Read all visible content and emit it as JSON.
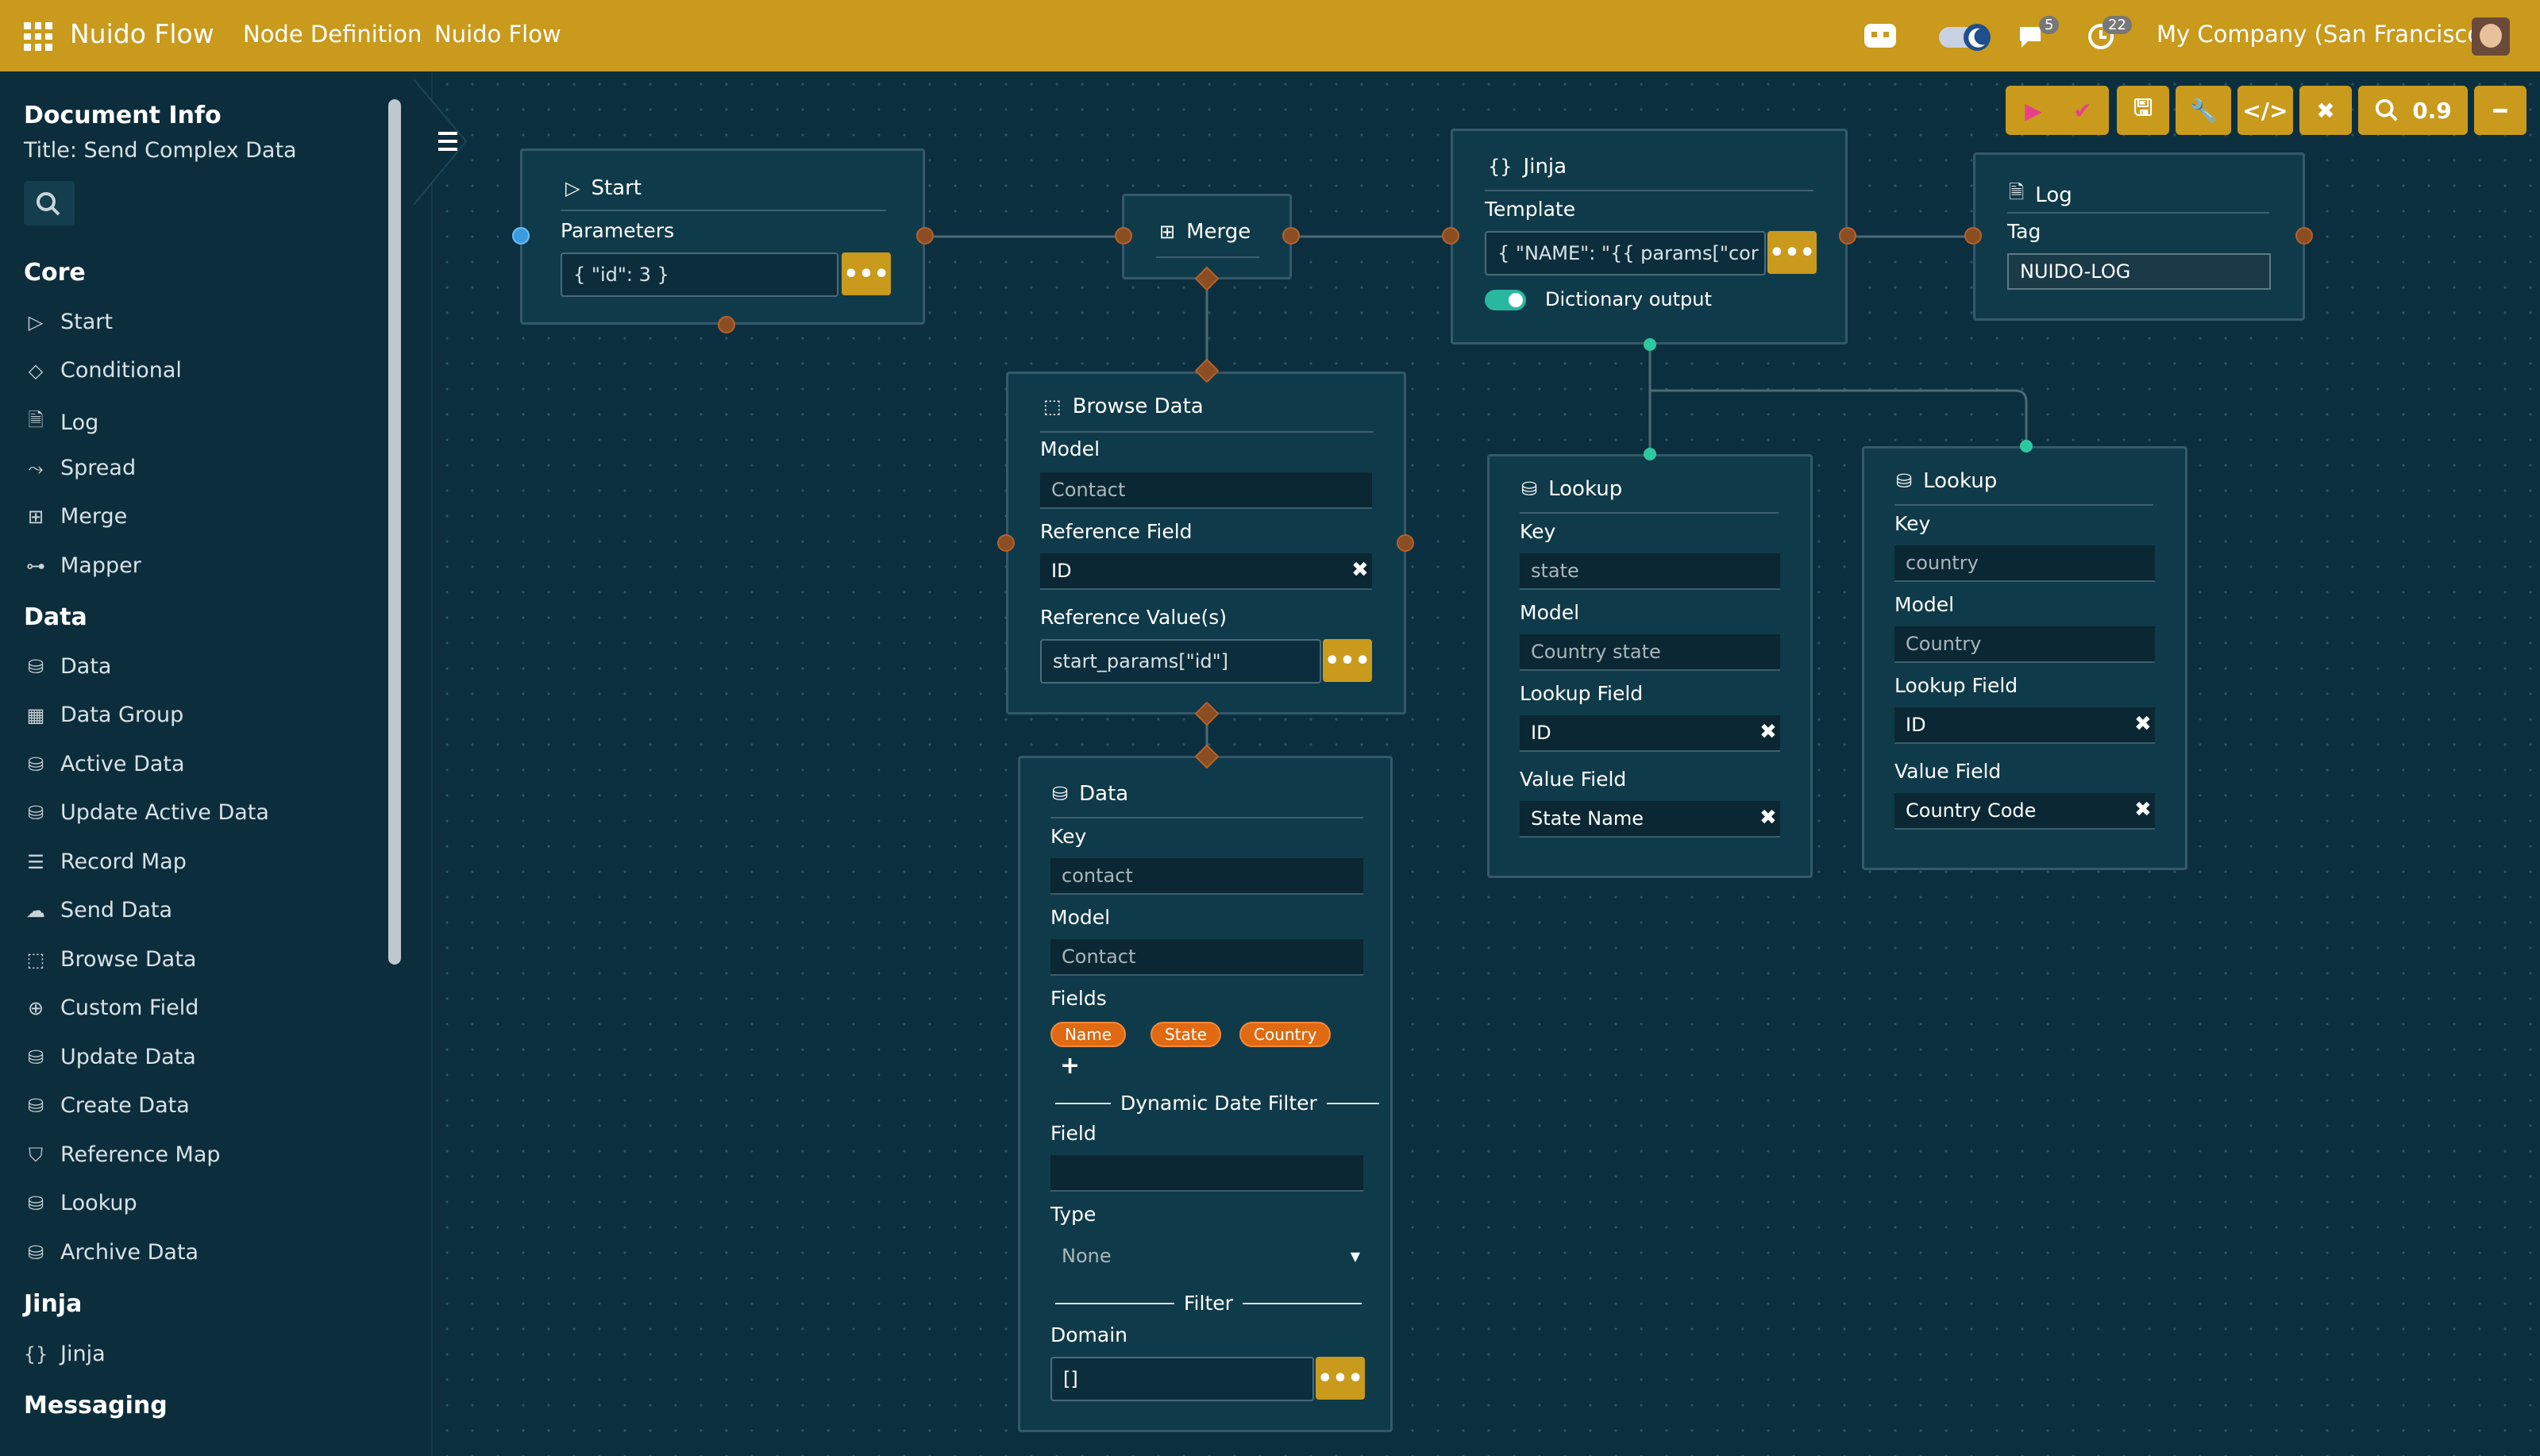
{
  "topbar": {
    "brand": "Nuido Flow",
    "menu": [
      "Node Definition",
      "Nuido Flow"
    ],
    "chat_count": "5",
    "activity_count": "22",
    "company": "My Company (San Francisco)"
  },
  "sidebar": {
    "doc_title": "Document Info",
    "doc_subtitle": "Title: Send Complex Data",
    "sections": {
      "core": "Core",
      "data": "Data",
      "jinja": "Jinja",
      "messaging": "Messaging"
    },
    "core_items": [
      "Start",
      "Conditional",
      "Log",
      "Spread",
      "Merge",
      "Mapper"
    ],
    "data_items": [
      "Data",
      "Data Group",
      "Active Data",
      "Update Active Data",
      "Record Map",
      "Send Data",
      "Browse Data",
      "Custom Field",
      "Update Data",
      "Create Data",
      "Reference Map",
      "Lookup",
      "Archive Data"
    ],
    "jinja_items": [
      "Jinja"
    ]
  },
  "toolbar": {
    "zoom": "0.9"
  },
  "nodes": {
    "start": {
      "title": "Start",
      "param_label": "Parameters",
      "param_value": "{ \"id\": 3 }"
    },
    "merge": {
      "title": "Merge"
    },
    "jinja": {
      "title": "Jinja",
      "template_label": "Template",
      "template_value": "{   \"NAME\": \"{{ params[\"cor",
      "dict_label": "Dictionary output"
    },
    "log": {
      "title": "Log",
      "tag_label": "Tag",
      "tag_value": "NUIDO-LOG"
    },
    "browse": {
      "title": "Browse Data",
      "model_label": "Model",
      "model_value": "Contact",
      "ref_field_label": "Reference Field",
      "ref_field_value": "ID",
      "ref_values_label": "Reference Value(s)",
      "ref_values_value": "start_params[\"id\"]"
    },
    "lookup1": {
      "title": "Lookup",
      "key_label": "Key",
      "key_value": "state",
      "model_label": "Model",
      "model_value": "Country state",
      "lookup_field_label": "Lookup Field",
      "lookup_field_value": "ID",
      "value_field_label": "Value Field",
      "value_field_value": "State Name"
    },
    "lookup2": {
      "title": "Lookup",
      "key_label": "Key",
      "key_value": "country",
      "model_label": "Model",
      "model_value": "Country",
      "lookup_field_label": "Lookup Field",
      "lookup_field_value": "ID",
      "value_field_label": "Value Field",
      "value_field_value": "Country Code"
    },
    "data": {
      "title": "Data",
      "key_label": "Key",
      "key_value": "contact",
      "model_label": "Model",
      "model_value": "Contact",
      "fields_label": "Fields",
      "fields": [
        "Name",
        "State",
        "Country"
      ],
      "ddf_label": "Dynamic Date Filter",
      "field_label": "Field",
      "field_value": "",
      "type_label": "Type",
      "type_value": "None",
      "filter_label": "Filter",
      "domain_label": "Domain",
      "domain_value": "[]"
    }
  },
  "colors": {
    "accent": "#c99a1c",
    "canvas": "#0b2f3e",
    "node": "#0f3a4a",
    "port": "#8a4e22",
    "chip": "#e06a12",
    "toggle": "#2ab7a0"
  }
}
